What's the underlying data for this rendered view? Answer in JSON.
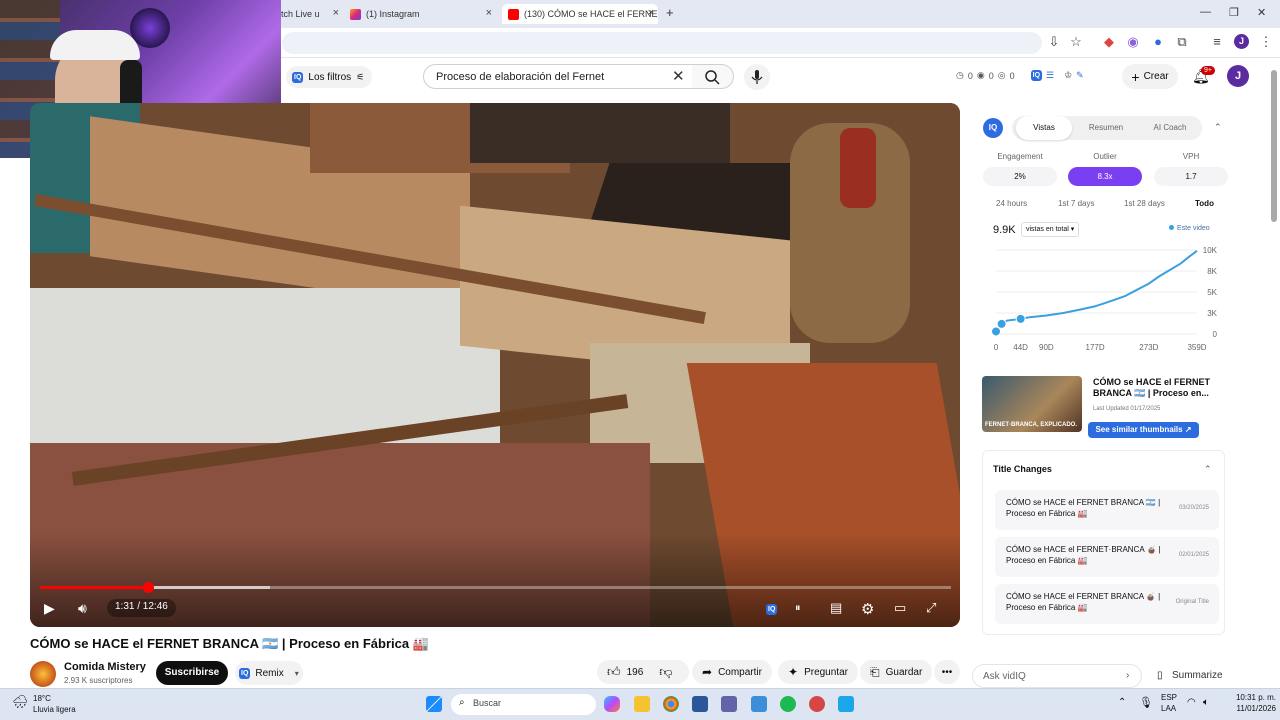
{
  "browser": {
    "tabs": [
      {
        "label": "tch Live u",
        "close": "×"
      },
      {
        "label": "(1) Instagram",
        "close": "×"
      },
      {
        "label": "(130) CÓMO se HACE el FERNE",
        "close": "×"
      }
    ],
    "new_tab": "+",
    "profile_initial": "J"
  },
  "youtube": {
    "filters_label": "Los filtros",
    "search_value": "Proceso de elaboración del Fernet",
    "mini_stats": [
      "0",
      "0",
      "0"
    ],
    "create_label": "Crear",
    "notif_badge": "9+",
    "avatar_initial": "J"
  },
  "player": {
    "time": "1:31 / 12:46",
    "progress_fraction": 0.119
  },
  "video": {
    "title": "CÓMO se HACE el FERNET BRANCA 🇦🇷 | Proceso en Fábrica 🏭",
    "channel_name": "Comida Mistery",
    "channel_subs": "2.93 K suscriptores",
    "subscribe_label": "Suscribirse",
    "remix_label": "Remix",
    "likes": "196",
    "share_label": "Compartir",
    "ask_label": "Preguntar",
    "save_label": "Guardar"
  },
  "vidiq": {
    "logo": "IQ",
    "tabs": [
      "Vistas",
      "Resumen",
      "AI Coach"
    ],
    "metrics": [
      {
        "label": "Engagement",
        "value": "2%"
      },
      {
        "label": "Outlier",
        "value": "8.3x"
      },
      {
        "label": "VPH",
        "value": "1.7"
      }
    ],
    "ranges": [
      "24 hours",
      "1st 7 days",
      "1st 28 days",
      "Todo"
    ],
    "views_total": "9.9K",
    "views_select": "vistas en total",
    "legend": "Este video",
    "thumb_caption": "FERNET·BRANCA, EXPLICADO.",
    "thumb_title": "CÓMO se HACE el FERNET BRANCA 🇦🇷 | Proceso en...",
    "thumb_updated": "Last Updated 01/17/2025",
    "similar_btn": "See similar thumbnails ↗",
    "title_changes_header": "Title Changes",
    "title_changes": [
      {
        "title": "CÓMO se HACE el FERNET BRANCA 🇦🇷 | Proceso en Fábrica 🏭",
        "date": "03/20/2025"
      },
      {
        "title": "CÓMO se HACE el FERNET·BRANCA 🧉 | Proceso en Fábrica 🏭",
        "date": "02/01/2025"
      },
      {
        "title": "CÓMO se HACE el FERNET BRANCA 🧉 | Proceso en Fábrica 🏭",
        "date": "Original Title"
      }
    ],
    "ask_placeholder": "Ask vidIQ",
    "summarize_label": "Summarize"
  },
  "chart_data": {
    "type": "line",
    "x": [
      0,
      10,
      20,
      44,
      60,
      90,
      120,
      150,
      177,
      200,
      230,
      250,
      273,
      290,
      310,
      330,
      345,
      359
    ],
    "values": [
      300,
      1200,
      1600,
      1800,
      2000,
      2200,
      2500,
      2900,
      3300,
      3800,
      4500,
      5200,
      6000,
      6800,
      7600,
      8400,
      9200,
      9900
    ],
    "x_ticks": [
      "0",
      "44D",
      "90D",
      "177D",
      "273D",
      "359D"
    ],
    "x_tick_values": [
      0,
      44,
      90,
      177,
      273,
      359
    ],
    "y_ticks": [
      "0",
      "3K",
      "5K",
      "8K",
      "10K"
    ],
    "y_tick_values": [
      0,
      2500,
      5000,
      7500,
      10000
    ],
    "xlim": [
      0,
      359
    ],
    "ylim": [
      0,
      10000
    ],
    "markers_x": [
      0,
      10,
      44
    ],
    "color": "#3aa0e0"
  },
  "taskbar": {
    "weather_temp": "18°C",
    "weather_desc": "Lluvia ligera",
    "search_placeholder": "Buscar",
    "lang": "ESP",
    "lang_sub": "LAA",
    "time": "10:31 p. m.",
    "date": "11/01/2026"
  }
}
